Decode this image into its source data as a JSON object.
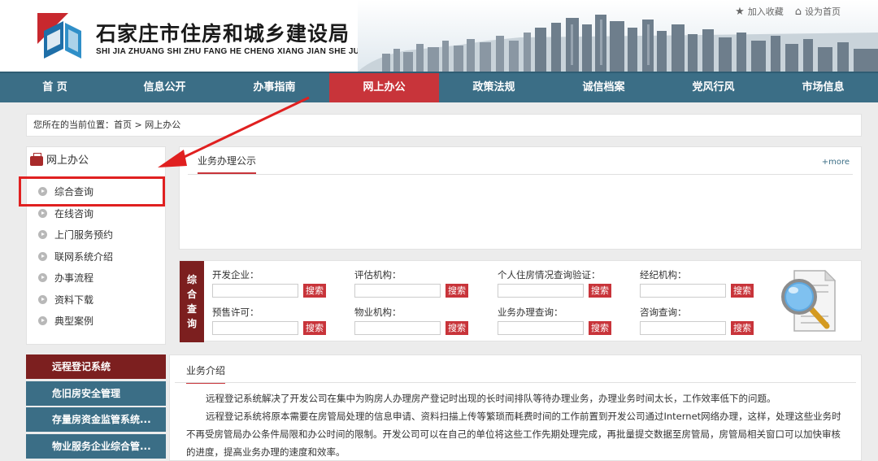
{
  "header": {
    "title": "石家庄市住房和城乡建设局",
    "subtitle": "SHI JIA ZHUANG SHI ZHU FANG HE CHENG XIANG JIAN SHE JU",
    "top_links": [
      {
        "label": "加入收藏",
        "icon": "star-icon"
      },
      {
        "label": "设为首页",
        "icon": "home-icon"
      }
    ]
  },
  "nav": {
    "items": [
      "首 页",
      "信息公开",
      "办事指南",
      "网上办公",
      "政策法规",
      "诚信档案",
      "党风行风",
      "市场信息"
    ],
    "active_index": 3
  },
  "breadcrumb": {
    "prefix": "您所在的当前位置：",
    "home": "首页",
    "sep": ">",
    "current": "网上办公"
  },
  "sidebar": {
    "title": "网上办公",
    "items": [
      "综合查询",
      "在线咨询",
      "上门服务预约",
      "联网系统介绍",
      "办事流程",
      "资料下载",
      "典型案例"
    ],
    "highlighted_index": 0
  },
  "notice_panel": {
    "tab": "业务办理公示",
    "more": "+more"
  },
  "search_panel": {
    "label_chars": [
      "综",
      "合",
      "查",
      "询"
    ],
    "button_label": "搜索",
    "fields": [
      {
        "label": "开发企业："
      },
      {
        "label": "评估机构："
      },
      {
        "label": "个人住房情况查询验证："
      },
      {
        "label": "经纪机构："
      },
      {
        "label": "预售许可："
      },
      {
        "label": "物业机构："
      },
      {
        "label": "业务办理查询："
      },
      {
        "label": "咨询查询："
      }
    ]
  },
  "systems_menu": {
    "items": [
      "远程登记系统",
      "危旧房安全管理",
      "存量房资金监管系统...",
      "物业服务企业综合管..."
    ],
    "active_index": 0
  },
  "intro_panel": {
    "tab": "业务介绍",
    "paragraphs": [
      "远程登记系统解决了开发公司在集中为购房人办理房产登记时出现的长时间排队等待办理业务，办理业务时间太长，工作效率低下的问题。",
      "远程登记系统将原本需要在房管局处理的信息申请、资料扫描上传等繁琐而耗费时间的工作前置到开发公司通过Internet网络办理，这样，处理这些业务时不再受房管局办公条件局限和办公时间的限制。开发公司可以在自己的单位将这些工作先期处理完成，再批量提交数据至房管局，房管局相关窗口可以加快审核的进度，提高业务办理的速度和效率。"
    ]
  },
  "colors": {
    "nav_bg": "#3b6e86",
    "nav_active": "#c8343a",
    "dark_red": "#7c1f1f",
    "highlight_red": "#e02020"
  }
}
